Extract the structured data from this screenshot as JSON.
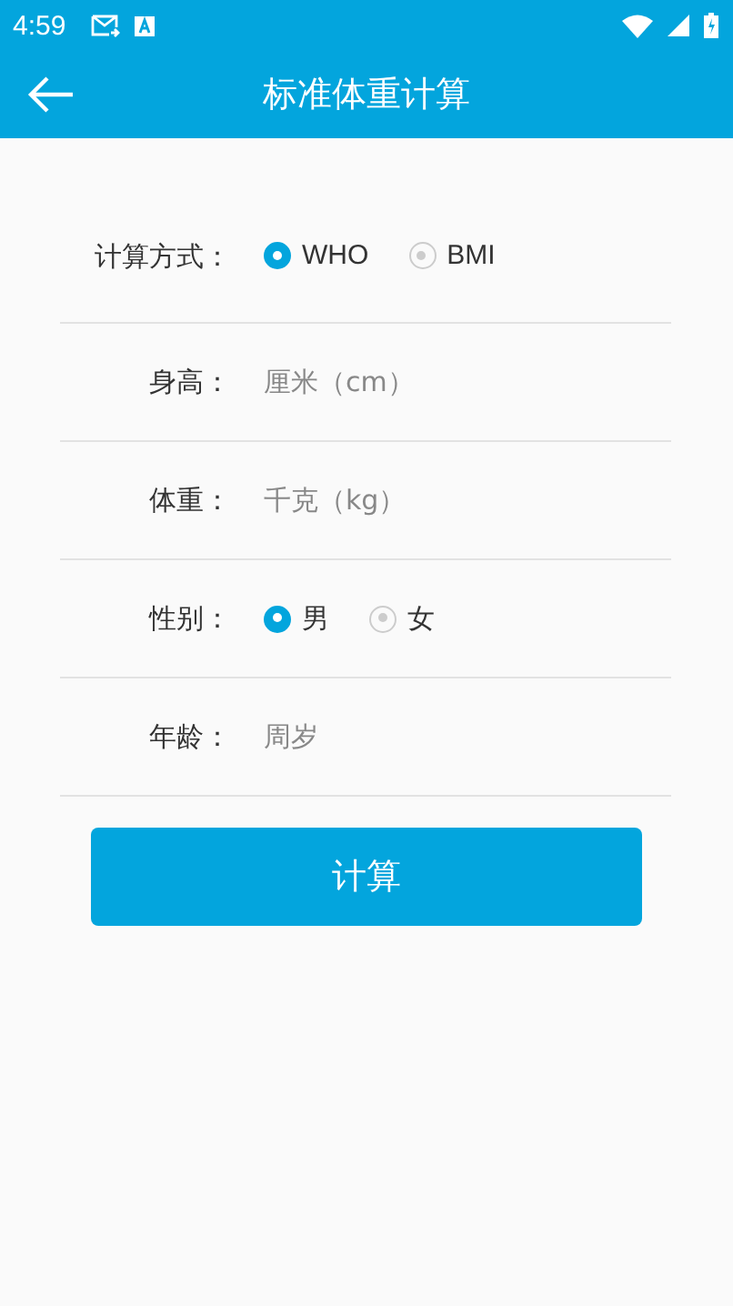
{
  "status_bar": {
    "time": "4:59"
  },
  "app_bar": {
    "title": "标准体重计算"
  },
  "form": [
    {
      "kind": "radio",
      "label": "计算方式：",
      "options": [
        {
          "label": "WHO",
          "selected": true
        },
        {
          "label": "BMI",
          "selected": false
        }
      ]
    },
    {
      "kind": "input",
      "label": "身高：",
      "placeholder": "厘米（cm）"
    },
    {
      "kind": "input",
      "label": "体重：",
      "placeholder": "千克（kg）"
    },
    {
      "kind": "radio",
      "label": "性别：",
      "options": [
        {
          "label": "男",
          "selected": true
        },
        {
          "label": "女",
          "selected": false
        }
      ]
    },
    {
      "kind": "input",
      "label": "年龄：",
      "placeholder": "周岁"
    }
  ],
  "button": "计算"
}
